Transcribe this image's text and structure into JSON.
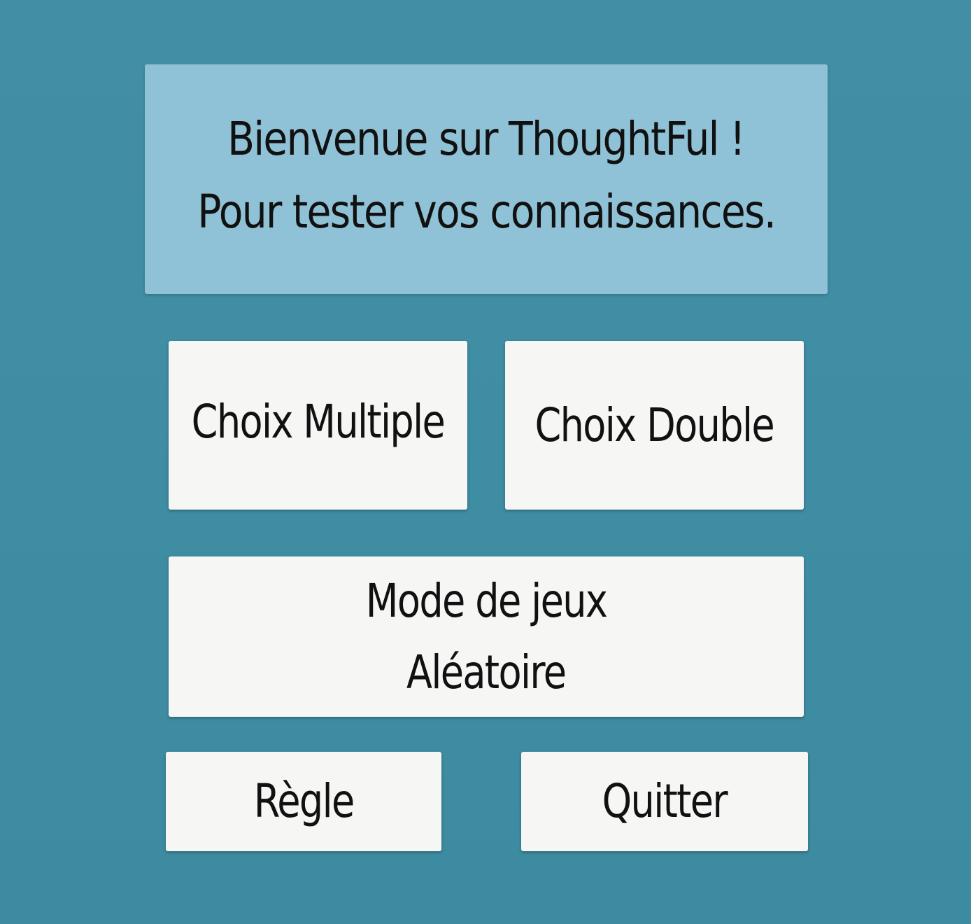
{
  "app": {
    "name": "ThoughtFul"
  },
  "welcome": {
    "line1": "Bienvenue sur ThoughtFul !",
    "line2": "Pour tester vos connaissances."
  },
  "menu": {
    "choix_multiple": "Choix Multiple",
    "choix_double": "Choix Double",
    "mode_aleatoire_line1": "Mode de jeux",
    "mode_aleatoire_line2": "Aléatoire",
    "regle": "Règle",
    "quitter": "Quitter"
  },
  "colors": {
    "background": "#3f8ea4",
    "welcome_panel": "#8fc2d6",
    "button": "#f6f6f5",
    "text": "#111111"
  }
}
